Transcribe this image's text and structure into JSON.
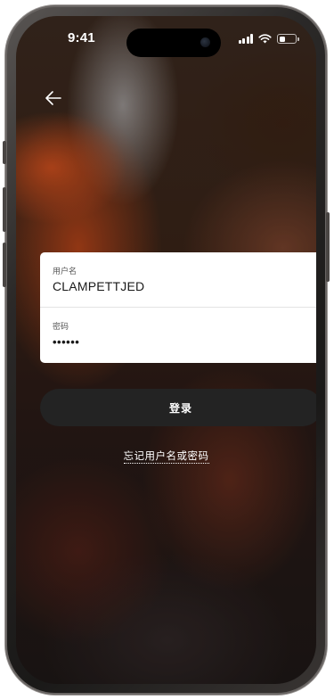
{
  "status_bar": {
    "time": "9:41",
    "battery_level": 0.35
  },
  "icons": {
    "back": "arrow-left-icon",
    "signal": "cellular-signal-icon",
    "wifi": "wifi-icon",
    "battery": "battery-icon"
  },
  "login_form": {
    "username_label": "用户名",
    "username_value": "CLAMPETTJED",
    "password_label": "密码",
    "password_value": "••••••"
  },
  "actions": {
    "login_label": "登录",
    "forgot_label": "忘记用户名或密码"
  },
  "colors": {
    "button_bg": "#232323",
    "card_bg": "#ffffff",
    "text_light": "#ffffff"
  }
}
